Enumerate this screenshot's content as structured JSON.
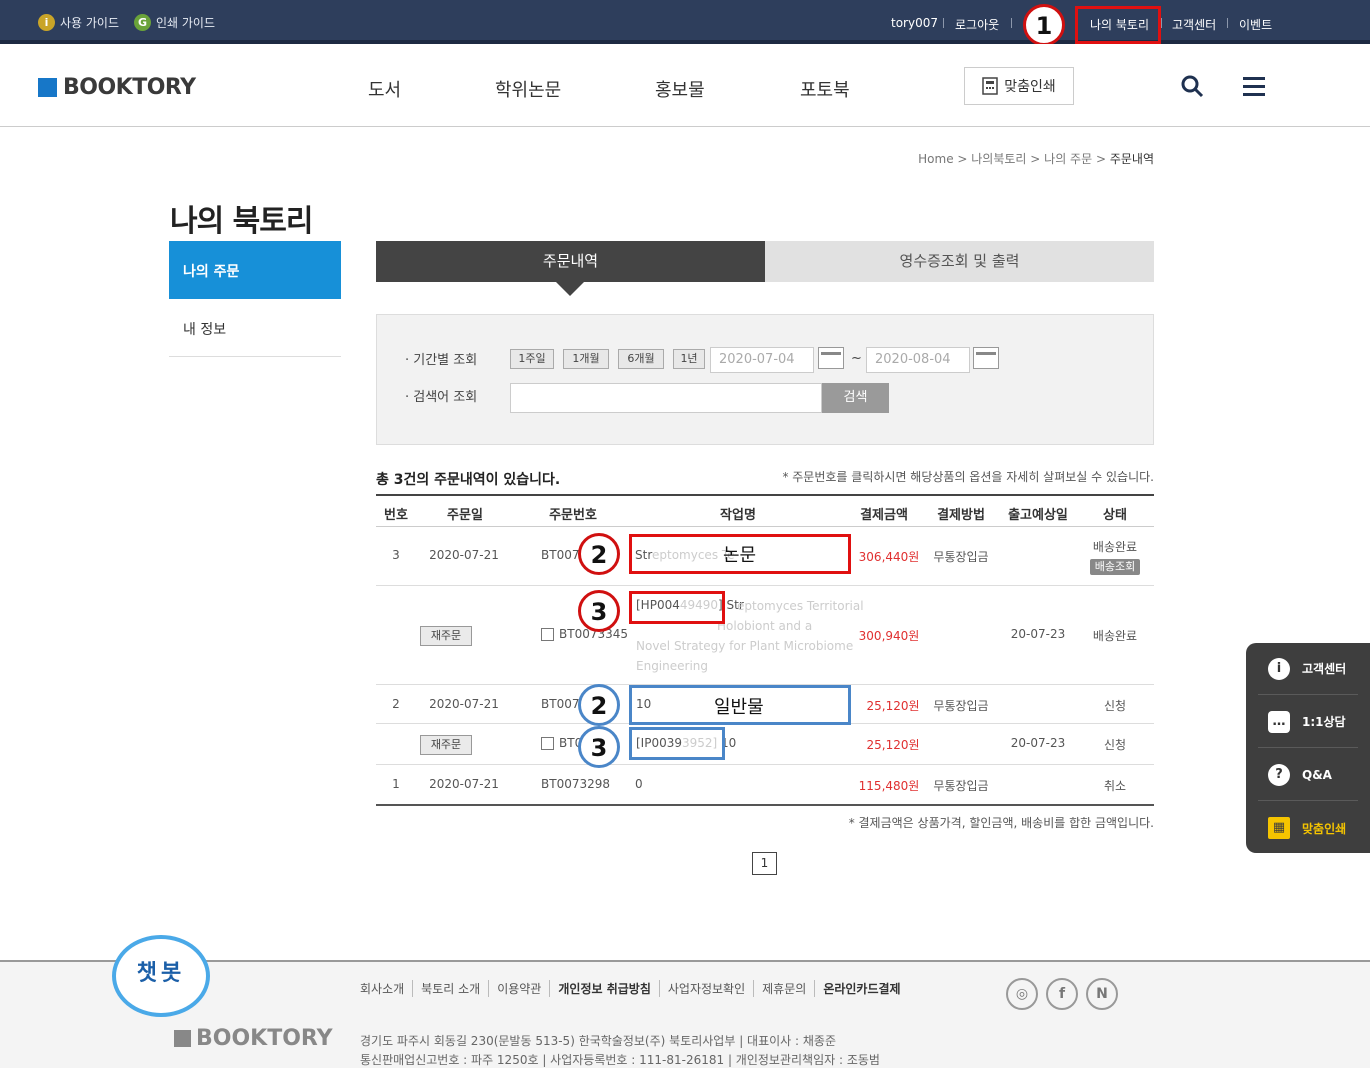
{
  "topbar": {
    "guide_usage": "사용 가이드",
    "guide_print": "인쇄 가이드",
    "guide_usage_icon": "i",
    "guide_print_icon": "G",
    "username": "tory007",
    "logout": "로그아웃",
    "my_booktory": "나의 북토리",
    "customer_center": "고객센터",
    "event": "이벤트"
  },
  "header": {
    "logo": "BOOKTORY",
    "nav": [
      "도서",
      "학위논문",
      "홍보물",
      "포토북"
    ],
    "custom_print": "맞춤인쇄"
  },
  "breadcrumb": {
    "home": "Home",
    "level1": "나의북토리",
    "level2": "나의 주문",
    "current": "주문내역"
  },
  "page_title": "나의 북토리",
  "sidebar": {
    "items": [
      {
        "label": "나의 주문",
        "active": true
      },
      {
        "label": "내 정보",
        "active": false
      }
    ]
  },
  "tabs": [
    {
      "label": "주문내역",
      "active": true
    },
    {
      "label": "영수증조회 및 출력",
      "active": false
    }
  ],
  "search": {
    "period_label": "· 기간별 조회",
    "keyword_label": "· 검색어 조회",
    "period_buttons": [
      "1주일",
      "1개월",
      "6개월",
      "1년"
    ],
    "date_from": "2020-07-04",
    "date_to": "2020-08-04",
    "tilde": "~",
    "search_button": "검색"
  },
  "list": {
    "count_text": "총 3건의 주문내역이 있습니다.",
    "note_top": "* 주문번호를 클릭하시면 해당상품의 옵션을 자세히 살펴보실 수 있습니다.",
    "note_bottom": "* 결제금액은 상품가격, 할인금액, 배송비를 합한 금액입니다.",
    "columns": [
      "번호",
      "주문일",
      "주문번호",
      "작업명",
      "결제금액",
      "결제방법",
      "출고예상일",
      "상태"
    ],
    "rows": {
      "r1": {
        "no": "3",
        "date": "2020-07-21",
        "order_no": "BT007",
        "work_prefix": "Str",
        "work_faded": "eptomyces Te",
        "amount": "306,440원",
        "method": "무통장입금",
        "status": "배송완료",
        "status_btn": "배송조회"
      },
      "r1s": {
        "reorder": "재주문",
        "order_no": "BT0073345",
        "work_code": "[HP004",
        "work_code_faded": "49490",
        "work_code_tail": "] Str",
        "work_lines": [
          "eptomyces Territorial",
          "Holobiont and a",
          "Novel Strategy for Plant Microbiome",
          "Engineering"
        ],
        "amount": "300,940원",
        "ship_date": "20-07-23",
        "status": "배송완료"
      },
      "r2": {
        "no": "2",
        "date": "2020-07-21",
        "order_no": "BT007",
        "work_prefix": "10",
        "amount": "25,120원",
        "method": "무통장입금",
        "status": "신청"
      },
      "r2s": {
        "reorder": "재주문",
        "order_no": "BT0",
        "work_code": "[IP0039",
        "work_code_faded": "3952]",
        "work_code_tail": " 10",
        "amount": "25,120원",
        "ship_date": "20-07-23",
        "status": "신청"
      },
      "r3": {
        "no": "1",
        "date": "2020-07-21",
        "order_no": "BT0073298",
        "work_prefix": "0",
        "amount": "115,480원",
        "method": "무통장입금",
        "status": "취소"
      }
    }
  },
  "annotations": {
    "mark1": "1",
    "mark2": "2",
    "mark3": "3",
    "label_thesis": "논문",
    "label_general": "일반물"
  },
  "pagination": {
    "current": "1"
  },
  "floating_menu": [
    {
      "label": "고객센터",
      "icon": "i"
    },
    {
      "label": "1:1상담",
      "icon": "…"
    },
    {
      "label": "Q&A",
      "icon": "?"
    },
    {
      "label": "맞춤인쇄",
      "icon": "▦"
    }
  ],
  "footer": {
    "chatbot": "챗봇",
    "logo": "BOOKTORY",
    "links": [
      "회사소개",
      "북토리 소개",
      "이용약관",
      "개인정보 취급방침",
      "사업자정보확인",
      "제휴문의",
      "온라인카드결제"
    ],
    "info1": "경기도 파주시 회동길 230(문발동 513-5) 한국학술정보(주) 북토리사업부 | 대표이사 : 채종준",
    "info2": "통신판매업신고번호 : 파주 1250호 | 사업자등록번호 : 111-81-26181 | 개인정보관리책임자 : 조동범",
    "sns": [
      "◎",
      "f",
      "N"
    ]
  },
  "colors": {
    "brand_blue": "#1790d8",
    "topbar": "#2e3e5c",
    "annotation_red": "#e01010",
    "annotation_blue": "#4a86c8",
    "price_red": "#e03030"
  }
}
